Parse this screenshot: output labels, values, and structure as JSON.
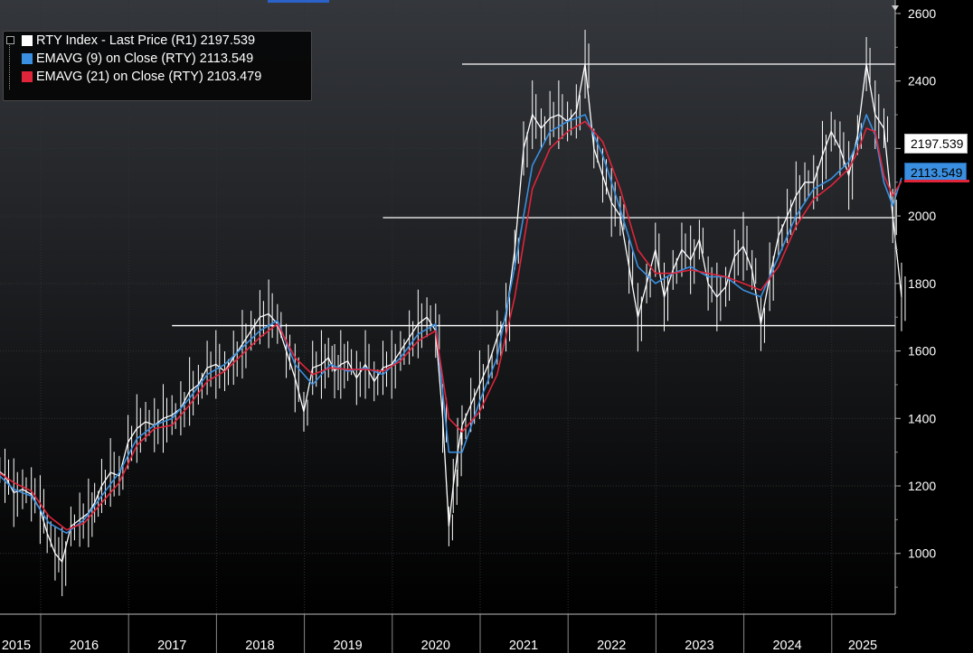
{
  "legend": {
    "items": [
      {
        "label": "RTY Index - Last Price (R1) 2197.539",
        "color": "#ffffff"
      },
      {
        "label": "EMAVG (9)  on Close (RTY)  2113.549",
        "color": "#3a8fe0"
      },
      {
        "label": "EMAVG (21)  on Close (RTY) 2103.479",
        "color": "#e0243a"
      }
    ]
  },
  "price_tags": {
    "last": "2197.539",
    "ema9": "2113.549"
  },
  "chart_data": {
    "type": "line",
    "title": "",
    "xlabel": "",
    "ylabel": "",
    "x_tick_labels": [
      "2015",
      "2016",
      "2017",
      "2018",
      "2019",
      "2020",
      "2021",
      "2022",
      "2023",
      "2024",
      "2025"
    ],
    "y_tick_labels": [
      "1000",
      "1200",
      "1400",
      "1600",
      "1800",
      "2000",
      "2200",
      "2400",
      "2600"
    ],
    "ylim": [
      820,
      2640
    ],
    "xlim": [
      2015.0,
      2025.35
    ],
    "grid": true,
    "legend_position": "top-left",
    "horizontal_levels": [
      {
        "value": 2450,
        "from": 2020.3
      },
      {
        "value": 1995,
        "from": 2019.4
      },
      {
        "value": 1675,
        "from": 2017.0
      }
    ],
    "colors": {
      "last": "#ffffff",
      "ema9": "#3a8fe0",
      "ema21": "#e0243a",
      "grid": "#3a3a3a",
      "background": "#000000"
    },
    "series": [
      {
        "name": "RTY Index - Last Price (R1)",
        "x": [
          2015.0,
          2015.1,
          2015.2,
          2015.3,
          2015.4,
          2015.5,
          2015.58,
          2015.67,
          2015.75,
          2015.85,
          2015.95,
          2016.05,
          2016.12,
          2016.2,
          2016.3,
          2016.4,
          2016.5,
          2016.6,
          2016.7,
          2016.8,
          2016.9,
          2017.0,
          2017.1,
          2017.2,
          2017.3,
          2017.4,
          2017.5,
          2017.6,
          2017.7,
          2017.8,
          2017.9,
          2018.0,
          2018.1,
          2018.2,
          2018.3,
          2018.4,
          2018.5,
          2018.6,
          2018.7,
          2018.78,
          2018.85,
          2018.92,
          2019.0,
          2019.1,
          2019.2,
          2019.3,
          2019.4,
          2019.5,
          2019.6,
          2019.7,
          2019.8,
          2019.9,
          2020.0,
          2020.08,
          2020.15,
          2020.2,
          2020.25,
          2020.3,
          2020.4,
          2020.5,
          2020.6,
          2020.7,
          2020.8,
          2020.9,
          2021.0,
          2021.1,
          2021.2,
          2021.3,
          2021.4,
          2021.5,
          2021.6,
          2021.7,
          2021.8,
          2021.9,
          2022.0,
          2022.1,
          2022.2,
          2022.3,
          2022.4,
          2022.5,
          2022.6,
          2022.7,
          2022.8,
          2022.9,
          2023.0,
          2023.1,
          2023.2,
          2023.3,
          2023.4,
          2023.5,
          2023.6,
          2023.7,
          2023.8,
          2023.9,
          2024.0,
          2024.1,
          2024.2,
          2024.3,
          2024.4,
          2024.5,
          2024.6,
          2024.7,
          2024.8,
          2024.9,
          2025.0,
          2025.1,
          2025.2,
          2025.3
        ],
        "values": [
          1250,
          1230,
          1180,
          1190,
          1175,
          1130,
          1060,
          1000,
          975,
          1080,
          1100,
          1120,
          1150,
          1200,
          1240,
          1230,
          1330,
          1370,
          1390,
          1380,
          1400,
          1410,
          1430,
          1480,
          1500,
          1550,
          1560,
          1540,
          1580,
          1620,
          1660,
          1700,
          1710,
          1680,
          1600,
          1520,
          1420,
          1550,
          1560,
          1580,
          1540,
          1560,
          1570,
          1520,
          1560,
          1510,
          1550,
          1560,
          1600,
          1640,
          1680,
          1700,
          1660,
          1400,
          1080,
          1200,
          1300,
          1380,
          1440,
          1500,
          1560,
          1640,
          1700,
          1900,
          2200,
          2300,
          2260,
          2290,
          2300,
          2280,
          2310,
          2450,
          2200,
          2120,
          2040,
          2000,
          1850,
          1700,
          1800,
          1900,
          1760,
          1840,
          1900,
          1870,
          1930,
          1800,
          1760,
          1790,
          1880,
          1910,
          1840,
          1680,
          1820,
          1940,
          2000,
          2060,
          2100,
          2100,
          2180,
          2250,
          2200,
          2120,
          2240,
          2450,
          2300,
          2260,
          2000,
          1760
        ]
      },
      {
        "name": "EMAVG (9)  on Close (RTY)",
        "x": [
          2015.0,
          2015.2,
          2015.4,
          2015.6,
          2015.8,
          2016.0,
          2016.2,
          2016.4,
          2016.6,
          2016.8,
          2017.0,
          2017.2,
          2017.4,
          2017.6,
          2017.8,
          2018.0,
          2018.2,
          2018.4,
          2018.6,
          2018.8,
          2019.0,
          2019.2,
          2019.4,
          2019.6,
          2019.8,
          2020.0,
          2020.15,
          2020.3,
          2020.5,
          2020.7,
          2020.9,
          2021.1,
          2021.3,
          2021.5,
          2021.7,
          2021.9,
          2022.1,
          2022.3,
          2022.5,
          2022.7,
          2022.9,
          2023.1,
          2023.3,
          2023.5,
          2023.7,
          2023.9,
          2024.1,
          2024.3,
          2024.5,
          2024.7,
          2024.8,
          2024.9,
          2025.0,
          2025.1,
          2025.2,
          2025.3
        ],
        "values": [
          1240,
          1190,
          1170,
          1090,
          1060,
          1100,
          1170,
          1240,
          1340,
          1380,
          1400,
          1460,
          1530,
          1560,
          1610,
          1660,
          1690,
          1560,
          1500,
          1560,
          1540,
          1550,
          1530,
          1580,
          1650,
          1680,
          1300,
          1300,
          1450,
          1580,
          1850,
          2150,
          2250,
          2280,
          2300,
          2180,
          2020,
          1850,
          1800,
          1830,
          1850,
          1820,
          1820,
          1780,
          1760,
          1880,
          2000,
          2080,
          2110,
          2160,
          2220,
          2300,
          2240,
          2100,
          2030,
          2113
        ]
      },
      {
        "name": "EMAVG (21)  on Close (RTY)",
        "x": [
          2015.0,
          2015.2,
          2015.4,
          2015.6,
          2015.8,
          2016.0,
          2016.2,
          2016.4,
          2016.6,
          2016.8,
          2017.0,
          2017.2,
          2017.4,
          2017.6,
          2017.8,
          2018.0,
          2018.2,
          2018.4,
          2018.6,
          2018.8,
          2019.0,
          2019.2,
          2019.4,
          2019.6,
          2019.8,
          2020.0,
          2020.15,
          2020.3,
          2020.5,
          2020.7,
          2020.9,
          2021.1,
          2021.3,
          2021.5,
          2021.7,
          2021.9,
          2022.1,
          2022.3,
          2022.5,
          2022.7,
          2022.9,
          2023.1,
          2023.3,
          2023.5,
          2023.7,
          2023.9,
          2024.1,
          2024.3,
          2024.5,
          2024.7,
          2024.8,
          2024.9,
          2025.0,
          2025.1,
          2025.2,
          2025.3
        ],
        "values": [
          1245,
          1210,
          1185,
          1110,
          1070,
          1090,
          1150,
          1210,
          1320,
          1370,
          1380,
          1440,
          1510,
          1540,
          1590,
          1640,
          1680,
          1580,
          1530,
          1550,
          1545,
          1545,
          1540,
          1570,
          1630,
          1660,
          1400,
          1360,
          1420,
          1530,
          1760,
          2080,
          2200,
          2250,
          2280,
          2220,
          2080,
          1900,
          1830,
          1830,
          1840,
          1830,
          1820,
          1800,
          1780,
          1850,
          1970,
          2050,
          2090,
          2140,
          2190,
          2260,
          2250,
          2120,
          2060,
          2103
        ]
      }
    ]
  }
}
